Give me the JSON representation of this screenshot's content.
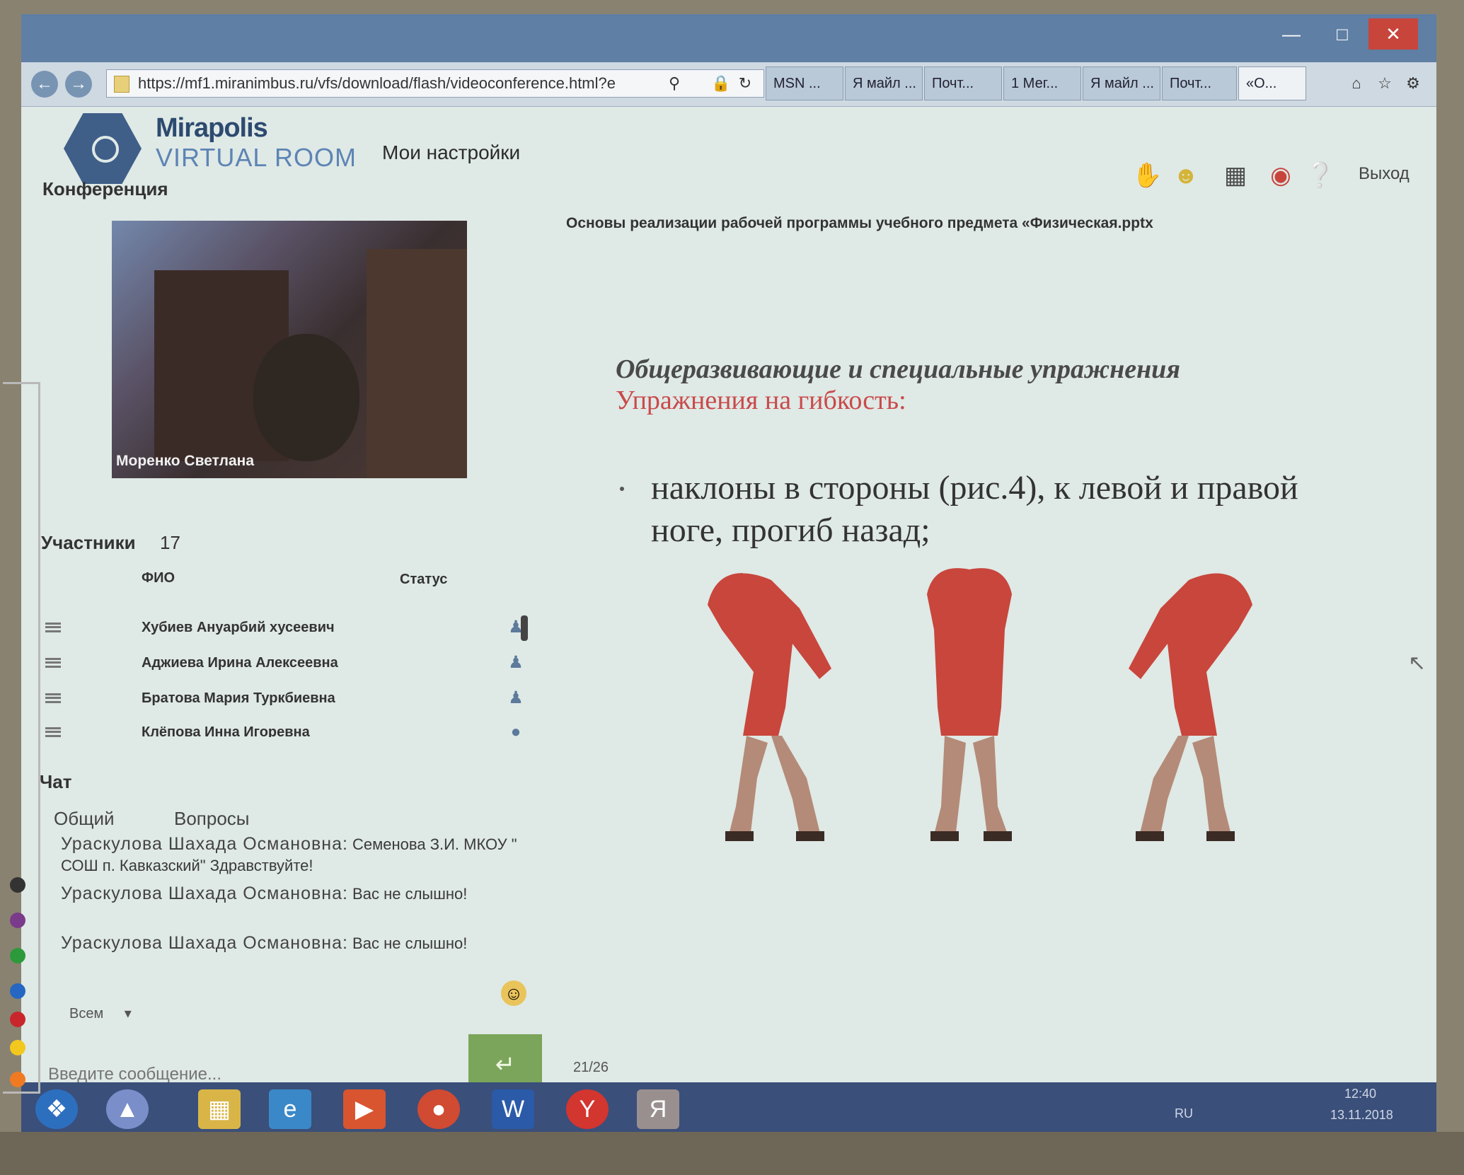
{
  "browser": {
    "url": "https://mf1.miranimbus.ru/vfs/download/flash/videoconference.html?e",
    "tabs": [
      "MSN ...",
      "Я майл ...",
      "Почт...",
      "1 Мег...",
      "Я майл ...",
      "Почт...",
      "«О..."
    ]
  },
  "header": {
    "brand_line1": "Mirapolis",
    "brand_line2": "VIRTUAL ROOM",
    "settings_label": "Мои настройки",
    "exit_label": "Выход"
  },
  "conference": {
    "title": "Конференция",
    "video_name": "Моренко Светлана"
  },
  "participants": {
    "title": "Участники",
    "count": "17",
    "col_name": "ФИО",
    "col_status": "Статус",
    "rows": [
      {
        "name": "Хубиев Ануарбий хусеевич"
      },
      {
        "name": "Аджиева Ирина Алексеевна"
      },
      {
        "name": "Братова Мария Туркбиевна"
      },
      {
        "name": "Клёпова Инна Игоревна"
      }
    ]
  },
  "chat": {
    "title": "Чат",
    "tab_general": "Общий",
    "tab_questions": "Вопросы",
    "messages": [
      {
        "author": "Ураскулова Шахада Османовна:",
        "text": "Семенова З.И. МКОУ \" СОШ п. Кавказский\" Здравствуйте!"
      },
      {
        "author": "Ураскулова Шахада Османовна:",
        "text": "Вас не слышно!"
      },
      {
        "author": "Ураскулова Шахада Османовна:",
        "text": "Вас не слышно!"
      }
    ],
    "recipient": "Всем",
    "input_placeholder": "Введите сообщение..."
  },
  "presentation": {
    "doc_title": "Основы реализации рабочей программы учебного предмета «Физическая.pptx",
    "heading": "Общеразвивающие и специальные упражнения",
    "subheading": "Упражнения на гибкость:",
    "body": "наклоны в стороны (рис.4), к левой и правой ноге, прогиб назад;",
    "page_counter": "21/26"
  },
  "taskbar": {
    "lang": "RU",
    "time": "12:40",
    "date": "13.11.2018"
  },
  "colors": {
    "brand": "#3f5f88",
    "accent_red": "#c94a4a",
    "send_green": "#7aa55a"
  }
}
